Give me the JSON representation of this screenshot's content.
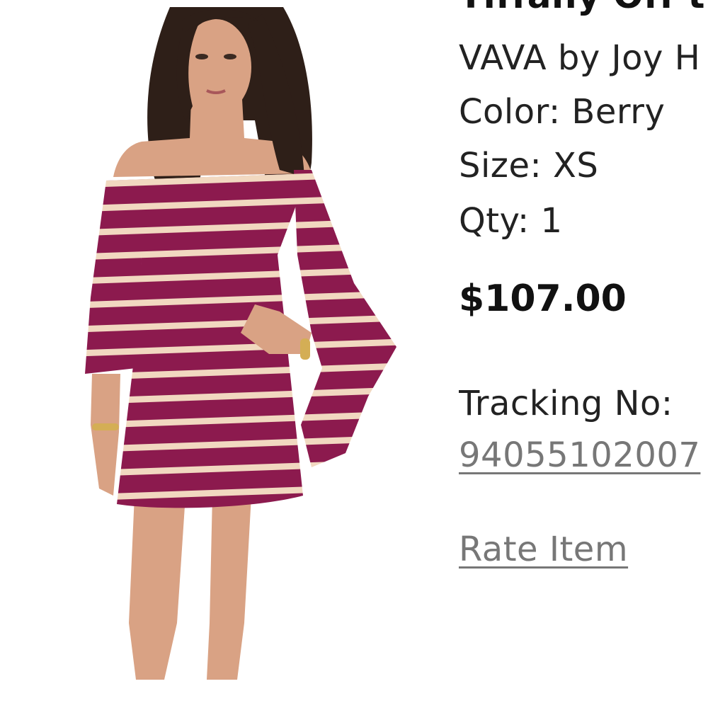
{
  "item": {
    "title": "Tiffany Off th",
    "brand": "VAVA by Joy H",
    "color": "Color: Berry",
    "size": "Size: XS",
    "qty": "Qty: 1",
    "price": "$107.00",
    "tracking_label": "Tracking No:",
    "tracking_number": "94055102007",
    "rate_label": "Rate Item"
  },
  "colors": {
    "dress": "#8c1a4e",
    "stripe": "#f1d8c0",
    "skin": "#d9a284",
    "hair": "#2e1f18",
    "link": "#777777"
  }
}
